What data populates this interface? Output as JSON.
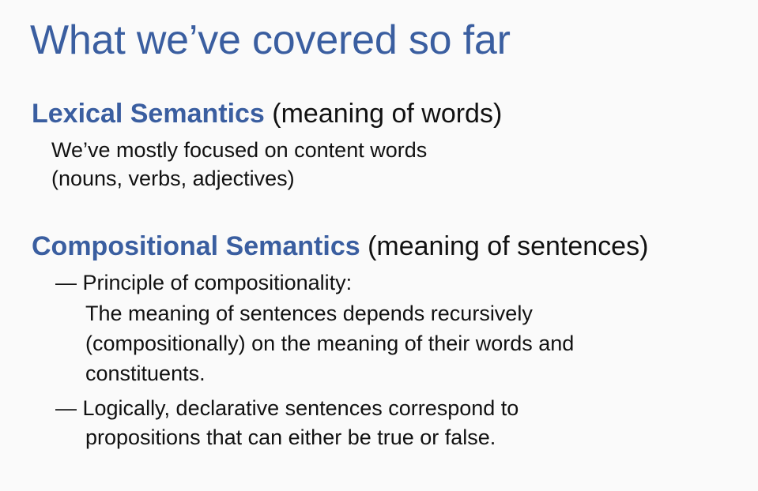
{
  "slide": {
    "title": "What we’ve covered so far",
    "lexical": {
      "term": "Lexical Semantics",
      "gloss": "(meaning of words)",
      "lines": [
        "We’ve mostly focused on content words",
        "(nouns, verbs, adjectives)"
      ]
    },
    "compositional": {
      "term": "Compositional Semantics",
      "gloss": "(meaning of sentences)",
      "bullets": [
        {
          "first": "— Principle of compositionality:",
          "continuation": [
            "The meaning of sentences depends recursively",
            "(compositionally) on the meaning of their words and",
            "constituents."
          ]
        },
        {
          "first": "— Logically, declarative sentences correspond to",
          "continuation": [
            "propositions that can either be true or false."
          ]
        }
      ]
    }
  },
  "colors": {
    "heading_blue": "#3a5ea0",
    "text": "#111111",
    "background": "#fafafa"
  }
}
